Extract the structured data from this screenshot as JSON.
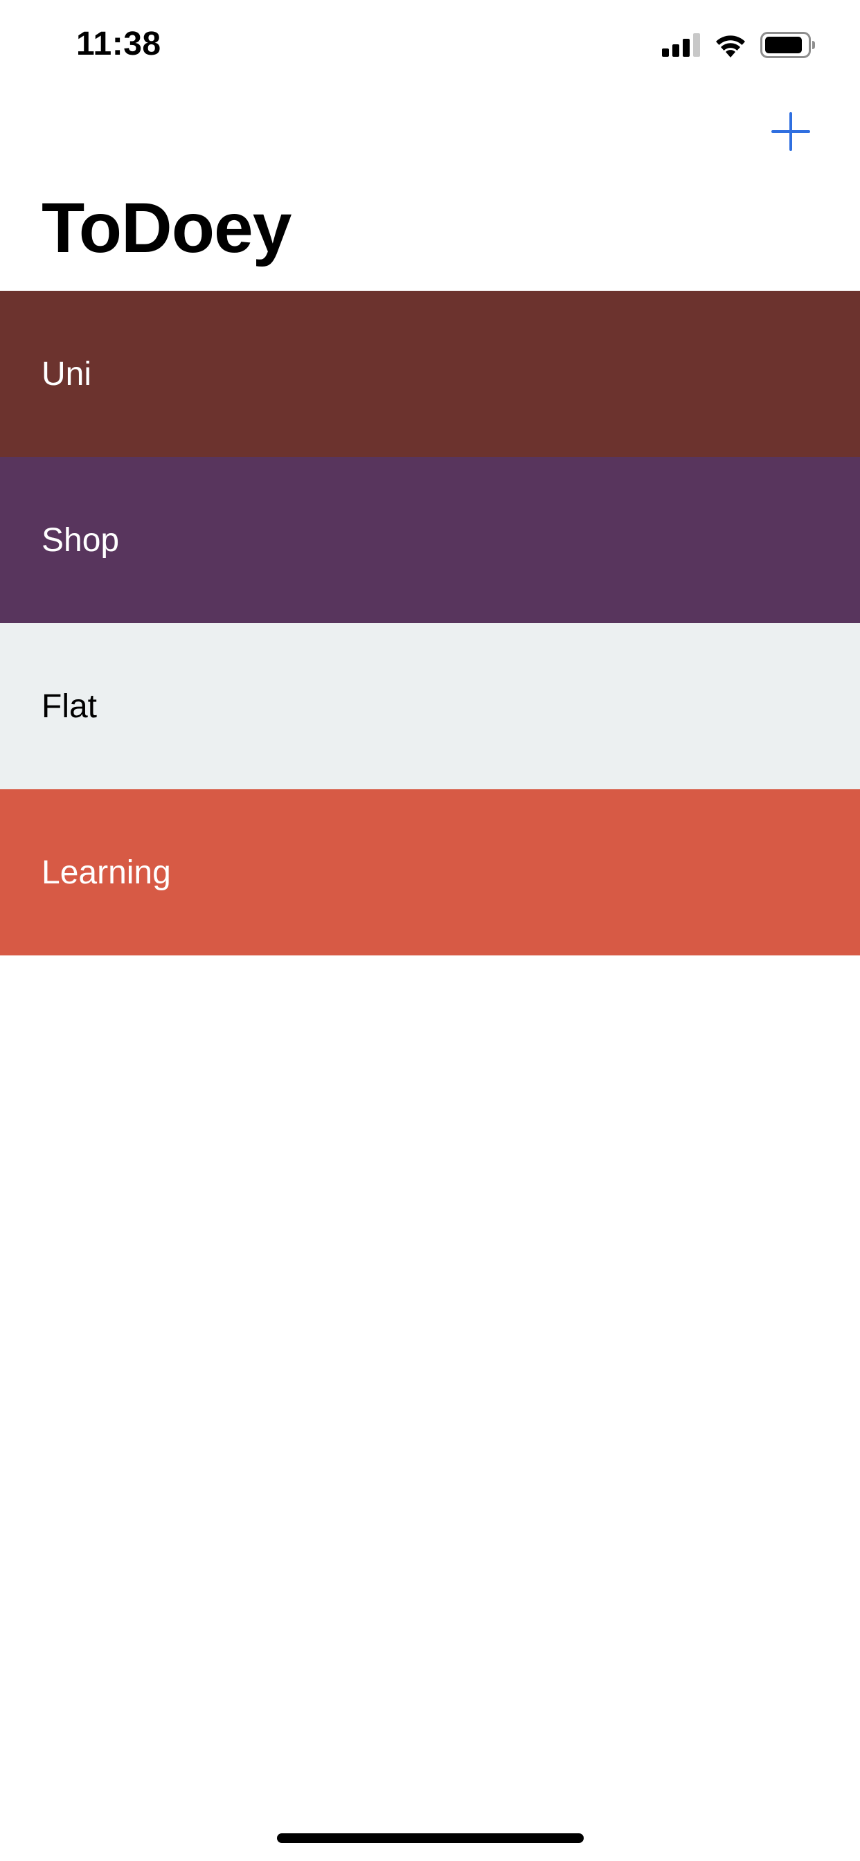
{
  "status_bar": {
    "time": "11:38",
    "icons": [
      "signal-icon",
      "wifi-icon",
      "battery-icon"
    ]
  },
  "nav": {
    "title": "ToDoey",
    "add_icon": "plus-icon",
    "accent_color": "#2f6fe0"
  },
  "categories": [
    {
      "label": "Uni",
      "background": "#6c332e",
      "text_color": "#ffffff"
    },
    {
      "label": "Shop",
      "background": "#58355d",
      "text_color": "#ffffff"
    },
    {
      "label": "Flat",
      "background": "#ecf0f1",
      "text_color": "#000000"
    },
    {
      "label": "Learning",
      "background": "#d75a45",
      "text_color": "#ffffff"
    }
  ]
}
